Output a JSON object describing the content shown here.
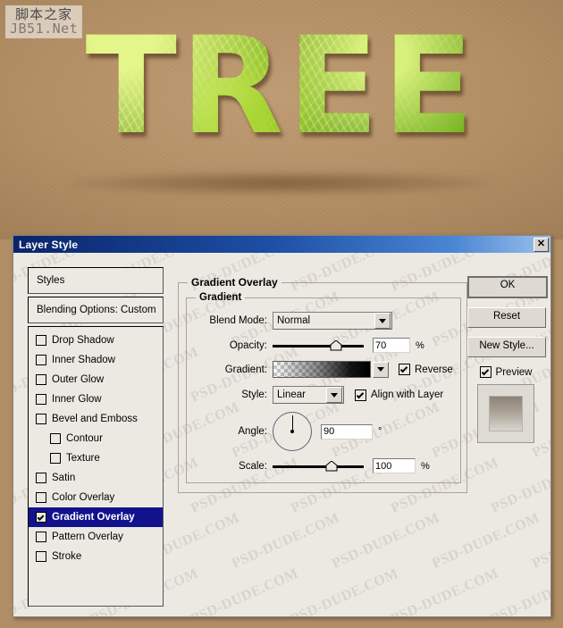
{
  "artwork": {
    "word": "TREE",
    "background_color": "#b08d64",
    "text_color": "#8fbe2a"
  },
  "site_logo": {
    "line1": "脚本之家",
    "line2": "JB51.Net"
  },
  "watermark": {
    "text": "PSD-DUDE.COM"
  },
  "dialog": {
    "title": "Layer Style",
    "close_label": "✕",
    "titlebar_color": "#0a246a"
  },
  "sidebar": {
    "styles_label": "Styles",
    "blending_label": "Blending Options: Custom",
    "effects": [
      {
        "label": "Drop Shadow",
        "checked": false,
        "sub": false,
        "selected": false
      },
      {
        "label": "Inner Shadow",
        "checked": false,
        "sub": false,
        "selected": false
      },
      {
        "label": "Outer Glow",
        "checked": false,
        "sub": false,
        "selected": false
      },
      {
        "label": "Inner Glow",
        "checked": false,
        "sub": false,
        "selected": false
      },
      {
        "label": "Bevel and Emboss",
        "checked": false,
        "sub": false,
        "selected": false
      },
      {
        "label": "Contour",
        "checked": false,
        "sub": true,
        "selected": false
      },
      {
        "label": "Texture",
        "checked": false,
        "sub": true,
        "selected": false
      },
      {
        "label": "Satin",
        "checked": false,
        "sub": false,
        "selected": false
      },
      {
        "label": "Color Overlay",
        "checked": false,
        "sub": false,
        "selected": false
      },
      {
        "label": "Gradient Overlay",
        "checked": true,
        "sub": false,
        "selected": true
      },
      {
        "label": "Pattern Overlay",
        "checked": false,
        "sub": false,
        "selected": false
      },
      {
        "label": "Stroke",
        "checked": false,
        "sub": false,
        "selected": false
      }
    ]
  },
  "panel": {
    "section_title": "Gradient Overlay",
    "group_title": "Gradient",
    "blend_mode": {
      "label": "Blend Mode:",
      "value": "Normal"
    },
    "opacity": {
      "label": "Opacity:",
      "value": "70",
      "unit": "%",
      "percent": 70
    },
    "gradient": {
      "label": "Gradient:"
    },
    "reverse": {
      "label": "Reverse",
      "checked": true
    },
    "style": {
      "label": "Style:",
      "value": "Linear"
    },
    "align_with_layer": {
      "label": "Align with Layer",
      "checked": true
    },
    "angle": {
      "label": "Angle:",
      "value": "90",
      "unit": "°",
      "degrees": 90
    },
    "scale": {
      "label": "Scale:",
      "value": "100",
      "unit": "%",
      "percent": 65
    }
  },
  "buttons": {
    "ok": "OK",
    "reset": "Reset",
    "new_style": "New Style...",
    "preview": {
      "label": "Preview",
      "checked": true
    }
  }
}
